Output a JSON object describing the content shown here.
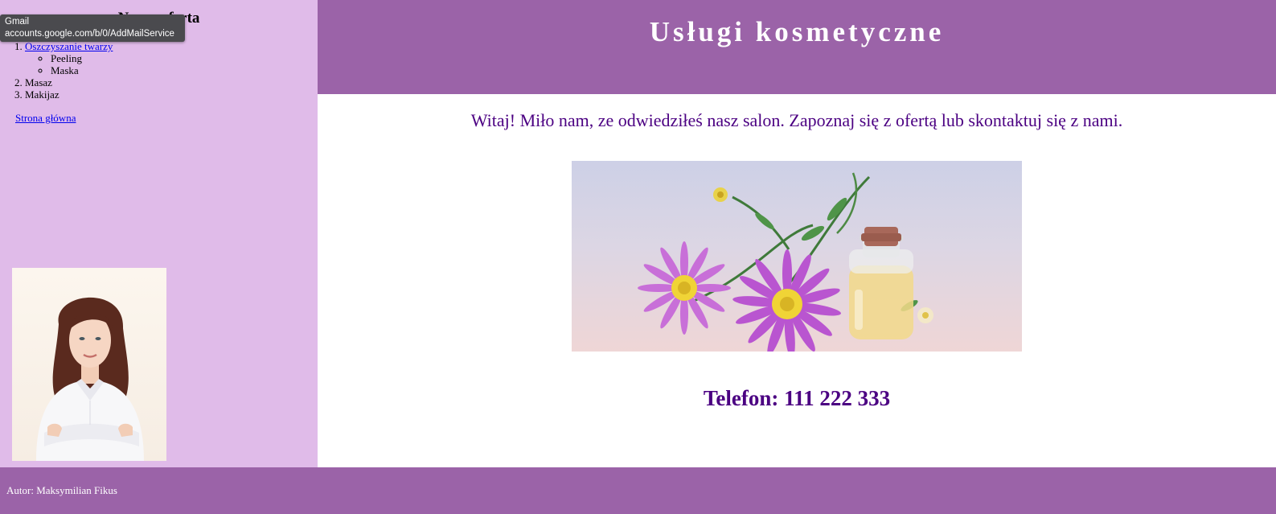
{
  "sidebar": {
    "heading": "Nasza oferta",
    "offer_list": [
      {
        "label": "Oszczyszanie twarzy",
        "link": true,
        "sub_items": [
          "Peeling",
          "Maska"
        ]
      },
      {
        "label": "Masaz",
        "link": false
      },
      {
        "label": "Makijaz",
        "link": false
      }
    ],
    "home_link": "Strona główna"
  },
  "tooltip": {
    "title": "Gmail",
    "url": "accounts.google.com/b/0/AddMailService"
  },
  "header": {
    "title": "Usługi kosmetyczne"
  },
  "main": {
    "welcome": "Witaj! Miło nam, ze odwiedziłeś nasz salon. Zapoznaj się z ofertą lub skontaktuj się z nami.",
    "phone": "Telefon: 111 222 333"
  },
  "footer": {
    "author": "Autor: Maksymilian Fikus"
  },
  "colors": {
    "sidebar_bg": "#e0bbe9",
    "header_bg": "#9b63a8",
    "text_accent": "#4b0082"
  }
}
